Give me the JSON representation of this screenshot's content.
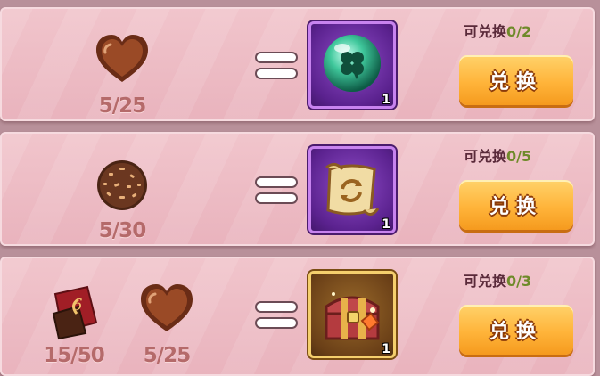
{
  "offers": [
    {
      "costs": [
        {
          "item": "heart-chocolate-icon",
          "count": "5/25"
        }
      ],
      "reward": {
        "item": "clover-orb-icon",
        "qty": "1",
        "frame": "purple"
      },
      "limit_label": "可兑换",
      "limit_value": "0/2",
      "button_label": "兑换"
    },
    {
      "costs": [
        {
          "item": "truffle-chocolate-icon",
          "count": "5/30"
        }
      ],
      "reward": {
        "item": "scroll-icon",
        "qty": "1",
        "frame": "purple"
      },
      "limit_label": "可兑换",
      "limit_value": "0/5",
      "button_label": "兑换"
    },
    {
      "costs": [
        {
          "item": "chocolate-bar-icon",
          "count": "15/50"
        },
        {
          "item": "heart-chocolate-icon",
          "count": "5/25"
        }
      ],
      "reward": {
        "item": "treasure-chest-icon",
        "qty": "1",
        "frame": "gold"
      },
      "limit_label": "可兑换",
      "limit_value": "0/3",
      "button_label": "兑换"
    }
  ],
  "colors": {
    "panel": "#e9b3bd",
    "count_text": "#b56a6a",
    "limit_current": "#6f8a2a",
    "button": "#ffb43a"
  }
}
